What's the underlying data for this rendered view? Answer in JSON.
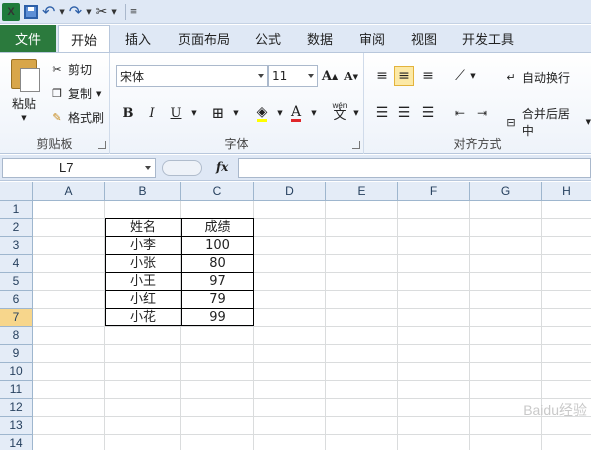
{
  "qat": {
    "logo": "X",
    "undo": "↶",
    "redo": "↷"
  },
  "tabs": [
    "文件",
    "开始",
    "插入",
    "页面布局",
    "公式",
    "数据",
    "审阅",
    "视图",
    "开发工具"
  ],
  "ribbon": {
    "clipboard": {
      "paste": "粘贴",
      "cut": "剪切",
      "copy": "复制",
      "format_painter": "格式刷",
      "label": "剪贴板"
    },
    "font": {
      "font_name": "宋体",
      "font_size": "11",
      "grow": "A",
      "shrink": "A",
      "bold": "B",
      "italic": "I",
      "underline": "U",
      "phonetic": "wén",
      "label": "字体"
    },
    "alignment": {
      "wrap_text": "自动换行",
      "merge_center": "合并后居中",
      "label": "对齐方式"
    }
  },
  "formula_bar": {
    "name_box": "L7",
    "fx": "fx",
    "value": ""
  },
  "columns": [
    "A",
    "B",
    "C",
    "D",
    "E",
    "F",
    "G",
    "H"
  ],
  "rows": [
    "1",
    "2",
    "3",
    "4",
    "5",
    "6",
    "7",
    "8",
    "9",
    "10",
    "11",
    "12",
    "13",
    "14"
  ],
  "selected_row": "7",
  "table": {
    "header": [
      "姓名",
      "成绩"
    ],
    "rows": [
      [
        "小李",
        "100"
      ],
      [
        "小张",
        "80"
      ],
      [
        "小王",
        "97"
      ],
      [
        "小红",
        "79"
      ],
      [
        "小花",
        "99"
      ]
    ]
  },
  "watermark": "Baidu经验",
  "colors": {
    "file_tab": "#2b7a3d",
    "selected_row_header": "#f7d68c",
    "ribbon_bg": "#dfe8f5"
  }
}
